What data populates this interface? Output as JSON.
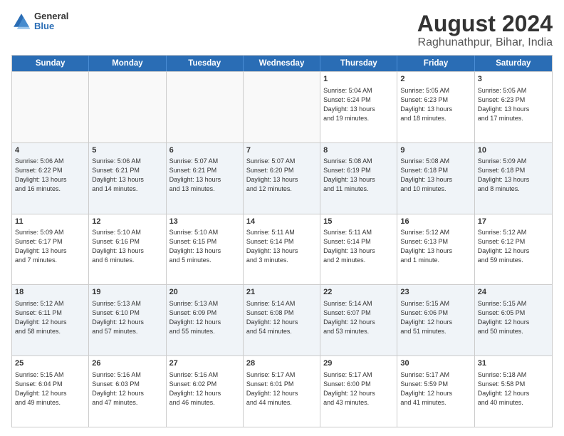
{
  "logo": {
    "general": "General",
    "blue": "Blue"
  },
  "title": "August 2024",
  "subtitle": "Raghunathpur, Bihar, India",
  "headers": [
    "Sunday",
    "Monday",
    "Tuesday",
    "Wednesday",
    "Thursday",
    "Friday",
    "Saturday"
  ],
  "weeks": [
    [
      {
        "day": "",
        "info": "",
        "empty": true
      },
      {
        "day": "",
        "info": "",
        "empty": true
      },
      {
        "day": "",
        "info": "",
        "empty": true
      },
      {
        "day": "",
        "info": "",
        "empty": true
      },
      {
        "day": "1",
        "info": "Sunrise: 5:04 AM\nSunset: 6:24 PM\nDaylight: 13 hours\nand 19 minutes."
      },
      {
        "day": "2",
        "info": "Sunrise: 5:05 AM\nSunset: 6:23 PM\nDaylight: 13 hours\nand 18 minutes."
      },
      {
        "day": "3",
        "info": "Sunrise: 5:05 AM\nSunset: 6:23 PM\nDaylight: 13 hours\nand 17 minutes."
      }
    ],
    [
      {
        "day": "4",
        "info": "Sunrise: 5:06 AM\nSunset: 6:22 PM\nDaylight: 13 hours\nand 16 minutes."
      },
      {
        "day": "5",
        "info": "Sunrise: 5:06 AM\nSunset: 6:21 PM\nDaylight: 13 hours\nand 14 minutes."
      },
      {
        "day": "6",
        "info": "Sunrise: 5:07 AM\nSunset: 6:21 PM\nDaylight: 13 hours\nand 13 minutes."
      },
      {
        "day": "7",
        "info": "Sunrise: 5:07 AM\nSunset: 6:20 PM\nDaylight: 13 hours\nand 12 minutes."
      },
      {
        "day": "8",
        "info": "Sunrise: 5:08 AM\nSunset: 6:19 PM\nDaylight: 13 hours\nand 11 minutes."
      },
      {
        "day": "9",
        "info": "Sunrise: 5:08 AM\nSunset: 6:18 PM\nDaylight: 13 hours\nand 10 minutes."
      },
      {
        "day": "10",
        "info": "Sunrise: 5:09 AM\nSunset: 6:18 PM\nDaylight: 13 hours\nand 8 minutes."
      }
    ],
    [
      {
        "day": "11",
        "info": "Sunrise: 5:09 AM\nSunset: 6:17 PM\nDaylight: 13 hours\nand 7 minutes."
      },
      {
        "day": "12",
        "info": "Sunrise: 5:10 AM\nSunset: 6:16 PM\nDaylight: 13 hours\nand 6 minutes."
      },
      {
        "day": "13",
        "info": "Sunrise: 5:10 AM\nSunset: 6:15 PM\nDaylight: 13 hours\nand 5 minutes."
      },
      {
        "day": "14",
        "info": "Sunrise: 5:11 AM\nSunset: 6:14 PM\nDaylight: 13 hours\nand 3 minutes."
      },
      {
        "day": "15",
        "info": "Sunrise: 5:11 AM\nSunset: 6:14 PM\nDaylight: 13 hours\nand 2 minutes."
      },
      {
        "day": "16",
        "info": "Sunrise: 5:12 AM\nSunset: 6:13 PM\nDaylight: 13 hours\nand 1 minute."
      },
      {
        "day": "17",
        "info": "Sunrise: 5:12 AM\nSunset: 6:12 PM\nDaylight: 12 hours\nand 59 minutes."
      }
    ],
    [
      {
        "day": "18",
        "info": "Sunrise: 5:12 AM\nSunset: 6:11 PM\nDaylight: 12 hours\nand 58 minutes."
      },
      {
        "day": "19",
        "info": "Sunrise: 5:13 AM\nSunset: 6:10 PM\nDaylight: 12 hours\nand 57 minutes."
      },
      {
        "day": "20",
        "info": "Sunrise: 5:13 AM\nSunset: 6:09 PM\nDaylight: 12 hours\nand 55 minutes."
      },
      {
        "day": "21",
        "info": "Sunrise: 5:14 AM\nSunset: 6:08 PM\nDaylight: 12 hours\nand 54 minutes."
      },
      {
        "day": "22",
        "info": "Sunrise: 5:14 AM\nSunset: 6:07 PM\nDaylight: 12 hours\nand 53 minutes."
      },
      {
        "day": "23",
        "info": "Sunrise: 5:15 AM\nSunset: 6:06 PM\nDaylight: 12 hours\nand 51 minutes."
      },
      {
        "day": "24",
        "info": "Sunrise: 5:15 AM\nSunset: 6:05 PM\nDaylight: 12 hours\nand 50 minutes."
      }
    ],
    [
      {
        "day": "25",
        "info": "Sunrise: 5:15 AM\nSunset: 6:04 PM\nDaylight: 12 hours\nand 49 minutes."
      },
      {
        "day": "26",
        "info": "Sunrise: 5:16 AM\nSunset: 6:03 PM\nDaylight: 12 hours\nand 47 minutes."
      },
      {
        "day": "27",
        "info": "Sunrise: 5:16 AM\nSunset: 6:02 PM\nDaylight: 12 hours\nand 46 minutes."
      },
      {
        "day": "28",
        "info": "Sunrise: 5:17 AM\nSunset: 6:01 PM\nDaylight: 12 hours\nand 44 minutes."
      },
      {
        "day": "29",
        "info": "Sunrise: 5:17 AM\nSunset: 6:00 PM\nDaylight: 12 hours\nand 43 minutes."
      },
      {
        "day": "30",
        "info": "Sunrise: 5:17 AM\nSunset: 5:59 PM\nDaylight: 12 hours\nand 41 minutes."
      },
      {
        "day": "31",
        "info": "Sunrise: 5:18 AM\nSunset: 5:58 PM\nDaylight: 12 hours\nand 40 minutes."
      }
    ]
  ]
}
